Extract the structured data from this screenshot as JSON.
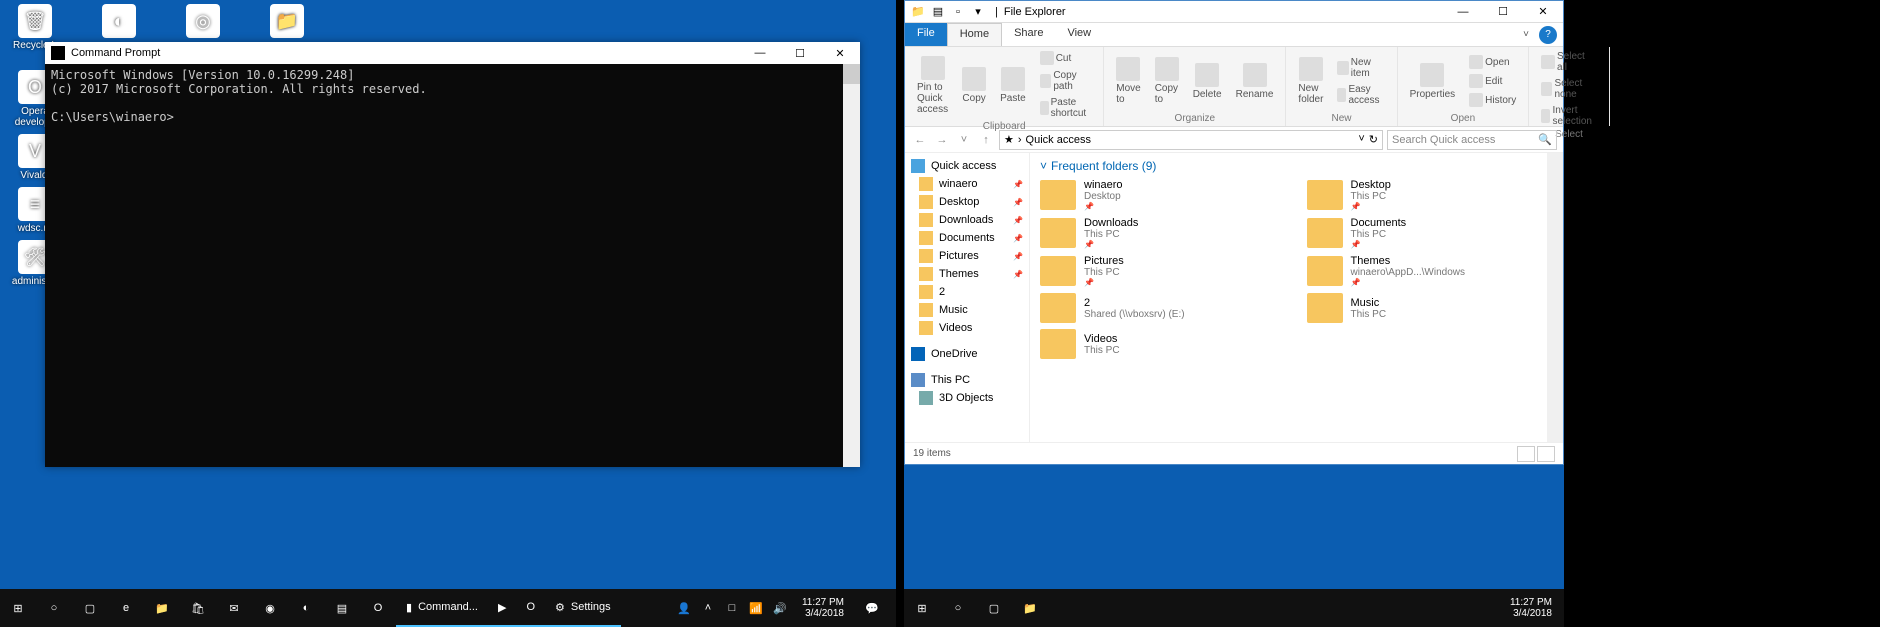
{
  "desktop_icons_row": [
    {
      "label": "Recycle L",
      "name": "recycle-bin-icon",
      "glyph": "🗑"
    },
    {
      "label": "",
      "name": "chrome-icon",
      "glyph": "◐"
    },
    {
      "label": "",
      "name": "firefox-icon",
      "glyph": "◎"
    },
    {
      "label": "",
      "name": "folder-icon",
      "glyph": "📁"
    }
  ],
  "desktop_icons_col": [
    {
      "label": "Opera develope",
      "name": "opera-dev-icon",
      "glyph": "O"
    },
    {
      "label": "Vivaldi",
      "name": "vivaldi-icon",
      "glyph": "V"
    },
    {
      "label": "wdsc.re",
      "name": "shortcut-icon",
      "glyph": "≡"
    },
    {
      "label": "administra",
      "name": "admin-tools-icon",
      "glyph": "🛠"
    }
  ],
  "cmd": {
    "title": "Command Prompt",
    "line1": "Microsoft Windows [Version 10.0.16299.248]",
    "line2": "(c) 2017 Microsoft Corporation. All rights reserved.",
    "prompt": "C:\\Users\\winaero>"
  },
  "taskbar_left": {
    "apps": [
      {
        "name": "start-icon",
        "glyph": "⊞"
      },
      {
        "name": "cortana-icon",
        "glyph": "○"
      },
      {
        "name": "taskview-icon",
        "glyph": "▢"
      },
      {
        "name": "edge-icon",
        "glyph": "e"
      },
      {
        "name": "explorer-icon",
        "glyph": "📁"
      },
      {
        "name": "store-icon",
        "glyph": "🛍"
      },
      {
        "name": "mail-icon",
        "glyph": "✉"
      },
      {
        "name": "spotify-icon",
        "glyph": "◉"
      },
      {
        "name": "waterfox-icon",
        "glyph": "◐"
      },
      {
        "name": "vscode-icon",
        "glyph": "▤"
      },
      {
        "name": "opera-icon",
        "glyph": "O"
      }
    ],
    "running": [
      {
        "name": "cmd-task",
        "label": "Command...",
        "glyph": "▮"
      },
      {
        "name": "powershell-task",
        "label": "",
        "glyph": "▶"
      },
      {
        "name": "opera-task",
        "label": "",
        "glyph": "O"
      },
      {
        "name": "settings-task",
        "label": "Settings",
        "glyph": "⚙"
      }
    ],
    "tray": [
      {
        "name": "people-icon",
        "glyph": "👤"
      },
      {
        "name": "tray-expand-icon",
        "glyph": "˄"
      },
      {
        "name": "action-icon",
        "glyph": "□"
      },
      {
        "name": "network-icon",
        "glyph": "📶"
      },
      {
        "name": "volume-icon",
        "glyph": "🔊"
      }
    ],
    "time": "11:27 PM",
    "date": "3/4/2018",
    "notif_glyph": "💬"
  },
  "explorer": {
    "title": "File Explorer",
    "tabs": {
      "file": "File",
      "home": "Home",
      "share": "Share",
      "view": "View"
    },
    "help_glyph": "?",
    "min_glyph": "˅",
    "ribbon": {
      "clipboard": {
        "pin": "Pin to Quick access",
        "copy": "Copy",
        "paste": "Paste",
        "cut": "Cut",
        "copypath": "Copy path",
        "pasteshort": "Paste shortcut",
        "label": "Clipboard"
      },
      "organize": {
        "moveto": "Move to",
        "copyto": "Copy to",
        "delete": "Delete",
        "rename": "Rename",
        "label": "Organize"
      },
      "new": {
        "newfolder": "New folder",
        "newitem": "New item",
        "easy": "Easy access",
        "label": "New"
      },
      "open": {
        "props": "Properties",
        "open": "Open",
        "edit": "Edit",
        "history": "History",
        "label": "Open"
      },
      "select": {
        "all": "Select all",
        "none": "Select none",
        "invert": "Invert selection",
        "label": "Select"
      }
    },
    "address": "Quick access",
    "search_placeholder": "Search Quick access",
    "nav": {
      "quick": "Quick access",
      "items": [
        {
          "label": "winaero",
          "name": "nav-winaero",
          "pinned": true
        },
        {
          "label": "Desktop",
          "name": "nav-desktop",
          "pinned": true
        },
        {
          "label": "Downloads",
          "name": "nav-downloads",
          "pinned": true
        },
        {
          "label": "Documents",
          "name": "nav-documents",
          "pinned": true
        },
        {
          "label": "Pictures",
          "name": "nav-pictures",
          "pinned": true
        },
        {
          "label": "Themes",
          "name": "nav-themes",
          "pinned": true
        },
        {
          "label": "2",
          "name": "nav-2",
          "pinned": false
        },
        {
          "label": "Music",
          "name": "nav-music",
          "pinned": false
        },
        {
          "label": "Videos",
          "name": "nav-videos",
          "pinned": false
        }
      ],
      "onedrive": "OneDrive",
      "thispc": "This PC",
      "objects3d": "3D Objects"
    },
    "frequent_header": "Frequent folders (9)",
    "folders": [
      {
        "name": "winaero",
        "path": "Desktop",
        "pinned": true
      },
      {
        "name": "Desktop",
        "path": "This PC",
        "pinned": true
      },
      {
        "name": "Downloads",
        "path": "This PC",
        "pinned": true
      },
      {
        "name": "Documents",
        "path": "This PC",
        "pinned": true
      },
      {
        "name": "Pictures",
        "path": "This PC",
        "pinned": true
      },
      {
        "name": "Themes",
        "path": "winaero\\AppD...\\Windows",
        "pinned": true
      },
      {
        "name": "2",
        "path": "Shared (\\\\vboxsrv) (E:)",
        "pinned": false
      },
      {
        "name": "Music",
        "path": "This PC",
        "pinned": false
      },
      {
        "name": "Videos",
        "path": "This PC",
        "pinned": false
      }
    ],
    "status": "19 items"
  },
  "taskbar_right": {
    "apps": [
      {
        "name": "start-icon",
        "glyph": "⊞"
      },
      {
        "name": "cortana-icon",
        "glyph": "○"
      },
      {
        "name": "taskview-icon",
        "glyph": "▢"
      },
      {
        "name": "explorer-icon",
        "glyph": "📁"
      }
    ],
    "time": "11:27 PM",
    "date": "3/4/2018"
  }
}
